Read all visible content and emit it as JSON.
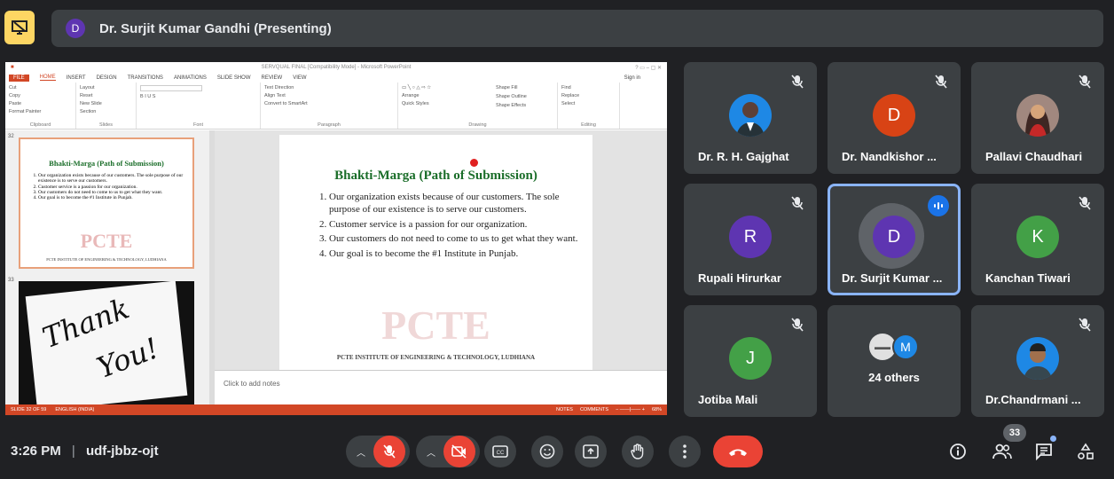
{
  "header": {
    "present_icon": "presenting-icon",
    "presenter_initial": "D",
    "banner_text": "Dr. Surjit Kumar Gandhi (Presenting)"
  },
  "powerpoint": {
    "window_title": "SERVQUAL FINAL [Compatibility Mode] - Microsoft PowerPoint",
    "tabs": [
      "FILE",
      "HOME",
      "INSERT",
      "DESIGN",
      "TRANSITIONS",
      "ANIMATIONS",
      "SLIDE SHOW",
      "REVIEW",
      "VIEW"
    ],
    "sign_in": "Sign in",
    "ribbon_groups": [
      "Clipboard",
      "Slides",
      "Font",
      "Paragraph",
      "Drawing",
      "Editing"
    ],
    "ribbon_items": {
      "cut": "Cut",
      "copy": "Copy",
      "paste": "Paste",
      "format_painter": "Format Painter",
      "new_slide": "New Slide",
      "layout": "Layout",
      "reset": "Reset",
      "section": "Section",
      "text_direction": "Text Direction",
      "align_text": "Align Text",
      "convert_smartart": "Convert to SmartArt",
      "arrange": "Arrange",
      "quick_styles": "Quick Styles",
      "shape_fill": "Shape Fill",
      "shape_outline": "Shape Outline",
      "shape_effects": "Shape Effects",
      "find": "Find",
      "replace": "Replace",
      "select": "Select"
    },
    "thumb1_number": "32",
    "thumb2_number": "33",
    "thumb2_text_1": "Thank",
    "thumb2_text_2": "You!",
    "slide": {
      "title": "Bhakti-Marga (Path of Submission)",
      "points": [
        "Our organization exists because of our customers. The sole purpose of our existence is to serve our customers.",
        "Customer service is a passion for our organization.",
        "Our customers do not need to come to us to get what they want.",
        "Our goal is to become the #1 Institute in Punjab."
      ],
      "watermark": "PCTE",
      "footer": "PCTE INSTITUTE OF ENGINEERING & TECHNOLOGY, LUDHIANA"
    },
    "notes_placeholder": "Click to add notes",
    "status": {
      "slide_of": "SLIDE 32 OF 59",
      "language": "ENGLISH (INDIA)",
      "notes": "NOTES",
      "comments": "COMMENTS",
      "zoom": "68%"
    }
  },
  "participants": [
    {
      "name": "Dr. R. H. Gajghat",
      "initial": "",
      "avatar_color": "#1e88e5",
      "muted": true,
      "photo": true
    },
    {
      "name": "Dr. Nandkishor ...",
      "initial": "D",
      "avatar_color": "#d84315",
      "muted": true,
      "photo": false
    },
    {
      "name": "Pallavi Chaudhari",
      "initial": "",
      "avatar_color": "#8d6e63",
      "muted": true,
      "photo": true
    },
    {
      "name": "Rupali Hirurkar",
      "initial": "R",
      "avatar_color": "#5e35b1",
      "muted": true,
      "photo": false
    },
    {
      "name": "Dr. Surjit Kumar ...",
      "initial": "D",
      "avatar_color": "#5e35b1",
      "muted": false,
      "photo": false,
      "speaking": true
    },
    {
      "name": "Kanchan Tiwari",
      "initial": "K",
      "avatar_color": "#43a047",
      "muted": true,
      "photo": false
    },
    {
      "name": "Jotiba Mali",
      "initial": "J",
      "avatar_color": "#43a047",
      "muted": true,
      "photo": false
    },
    {
      "name": "24 others",
      "initial": "M",
      "avatar_color": "#1e88e5",
      "muted": false,
      "photo": false
    },
    {
      "name": "Dr.Chandrmani ...",
      "initial": "",
      "avatar_color": "#1e88e5",
      "muted": true,
      "photo": true
    }
  ],
  "bottom": {
    "time": "3:26 PM",
    "separator": "|",
    "meeting_code": "udf-jbbz-ojt",
    "participant_count": "33"
  },
  "colors": {
    "accent_red": "#ea4335",
    "accent_blue": "#8ab4f8",
    "presenting_yellow": "#fdd663",
    "tile_bg": "#3c4043",
    "bg": "#202124"
  }
}
